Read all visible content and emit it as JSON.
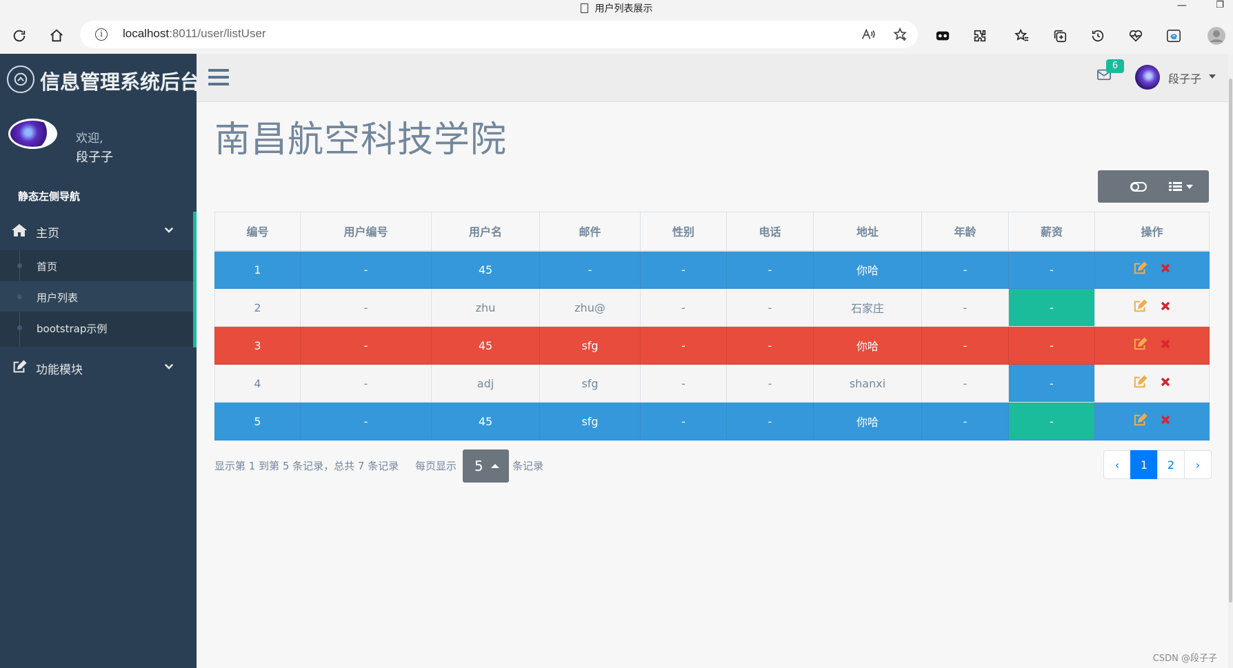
{
  "browser": {
    "tab_title": "用户列表展示",
    "url_host": "localhost",
    "url_rest": ":8011/user/listUser",
    "window_minimize": "—",
    "window_restore": "❐"
  },
  "sidebar": {
    "brand": "信息管理系统后台",
    "welcome": "欢迎,",
    "user_name": "段子子",
    "menu_heading": "静态左侧导航",
    "menu": [
      {
        "label": "主页",
        "icon": "home-icon",
        "children": [
          "首页",
          "用户列表",
          "bootstrap示例"
        ]
      },
      {
        "label": "功能模块",
        "icon": "edit-icon"
      }
    ]
  },
  "topnav": {
    "mail_count": "6",
    "user_name": "段子子"
  },
  "page": {
    "title": "南昌航空科技学院"
  },
  "table": {
    "headers": [
      "编号",
      "用户编号",
      "用户名",
      "邮件",
      "性别",
      "电话",
      "地址",
      "年龄",
      "薪资",
      "操作"
    ],
    "rows": [
      [
        "1",
        "-",
        "45",
        "-",
        "-",
        "-",
        "你哈",
        "-",
        "-"
      ],
      [
        "2",
        "-",
        "zhu",
        "zhu@",
        "-",
        "-",
        "石家庄",
        "-",
        "-"
      ],
      [
        "3",
        "-",
        "45",
        "sfg",
        "-",
        "-",
        "你哈",
        "-",
        "-"
      ],
      [
        "4",
        "-",
        "adj",
        "sfg",
        "-",
        "-",
        "shanxi",
        "-",
        "-"
      ],
      [
        "5",
        "-",
        "45",
        "sfg",
        "-",
        "-",
        "你哈",
        "-",
        "-"
      ]
    ]
  },
  "pager": {
    "summary": "显示第 1 到第 5 条记录，总共 7 条记录",
    "per_page_prefix": "每页显示",
    "page_size": "5",
    "per_page_suffix": "条记录",
    "prev": "‹",
    "pages": [
      "1",
      "2"
    ],
    "next": "›",
    "current": "1"
  },
  "colors": {
    "sidebar": "#2a3f54",
    "row_blue": "#3498db",
    "row_red": "#e74c3c",
    "cell_green": "#1abc9c",
    "accent": "#007bff",
    "edit_icon": "#f0ad4e",
    "delete_icon": "#d9232d"
  },
  "watermark": "CSDN @段子子"
}
